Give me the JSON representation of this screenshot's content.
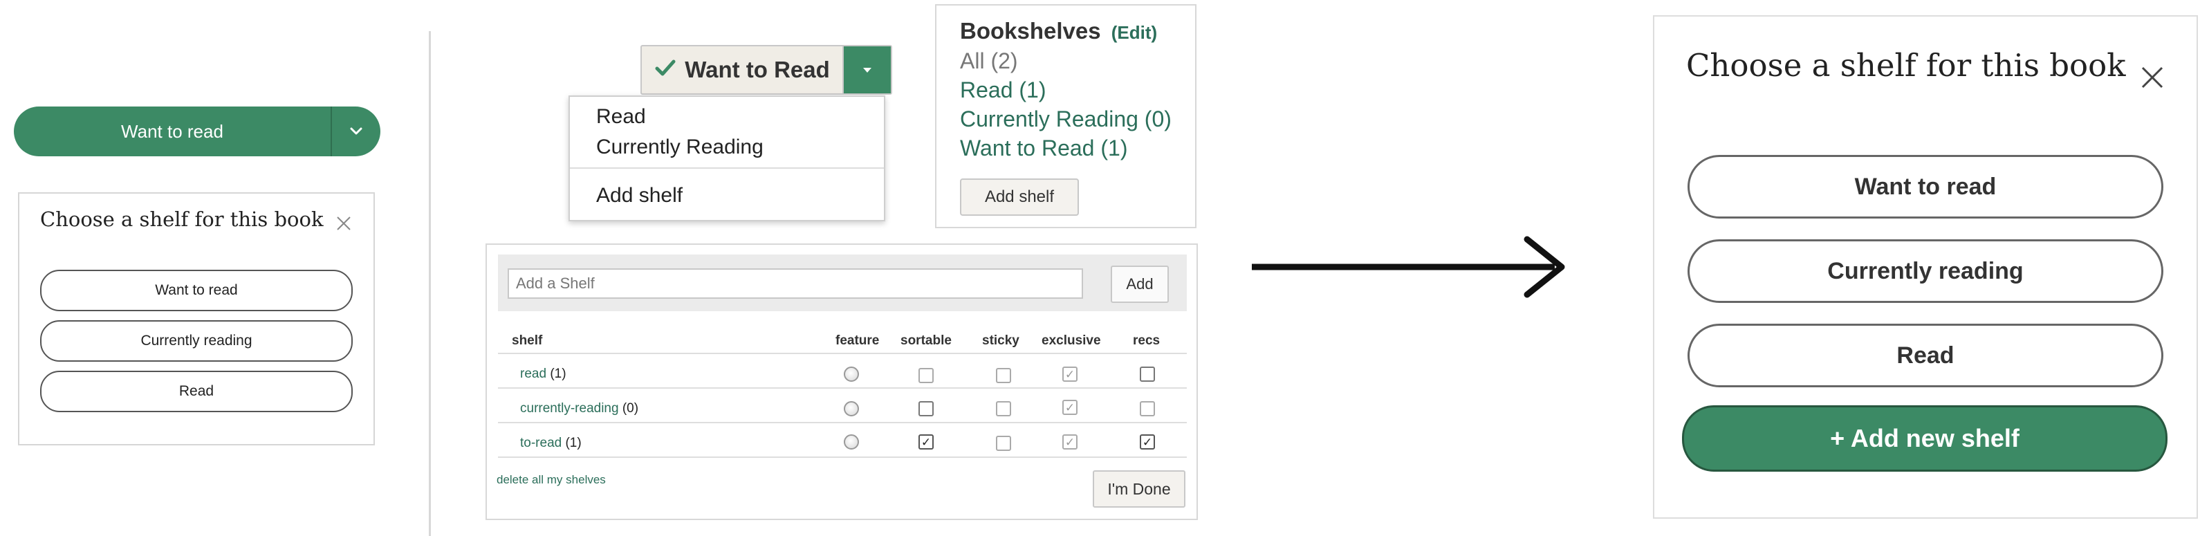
{
  "panel_a": {
    "split_button": {
      "label": "Want to read"
    },
    "dialog": {
      "title": "Choose a shelf for this book",
      "options": [
        "Want to read",
        "Currently reading",
        "Read"
      ]
    }
  },
  "panel_b": {
    "status_button": {
      "label": "Want to Read"
    },
    "dropdown": {
      "items": [
        "Read",
        "Currently Reading"
      ],
      "add_shelf": "Add shelf"
    },
    "bookshelves": {
      "title": "Bookshelves",
      "edit": "(Edit)",
      "rows": [
        "All (2)",
        "Read (1)",
        "Currently Reading (0)",
        "Want to Read (1)"
      ],
      "add_shelf": "Add shelf"
    },
    "shelf_editor": {
      "placeholder": "Add a Shelf",
      "add_button": "Add",
      "columns": [
        "shelf",
        "feature",
        "sortable",
        "sticky",
        "exclusive",
        "recs"
      ],
      "rows": [
        {
          "name": "read",
          "count": "(1)"
        },
        {
          "name": "currently-reading",
          "count": "(0)"
        },
        {
          "name": "to-read",
          "count": "(1)"
        }
      ],
      "delete_link": "delete all my shelves",
      "done_button": "I'm Done"
    }
  },
  "panel_c": {
    "title": "Choose a shelf for this book",
    "options": [
      "Want to read",
      "Currently reading",
      "Read"
    ],
    "primary_button": "+ Add new shelf"
  },
  "colors": {
    "brand_green": "#3c8a65",
    "link_green": "#2b6e5a",
    "gray_text": "#777777"
  }
}
